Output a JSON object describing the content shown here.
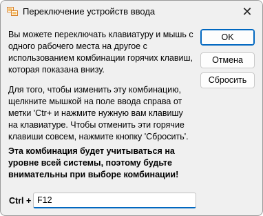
{
  "window": {
    "title": "Переключение устройств ввода",
    "close_symbol": "✕",
    "accent": "#0067c0"
  },
  "text": {
    "p1": "Вы можете переключать клавиатуру и мышь с одного рабочего места на другое с использованием комбинации горячих клавиш, которая показана внизу.",
    "p2": "Для того, чтобы изменить эту комбинацию, щелкните мышкой на поле ввода справа от метки 'Ctr+ и нажмите нужную вам клавишу на клавиатуре. Чтобы отменить эти горячие клавиши совсем, нажмите кнопку 'Сбросить'.",
    "p3": "Эта комбинация будет учитываться на уровне всей системы, поэтому будьте внимательны при выборе комбинации!"
  },
  "buttons": {
    "ok": "OK",
    "cancel": "Отмена",
    "reset": "Сбросить"
  },
  "hotkey": {
    "label": "Ctrl +",
    "value": "F12"
  },
  "icons": {
    "title": "input-devices-icon",
    "close": "close-icon"
  }
}
